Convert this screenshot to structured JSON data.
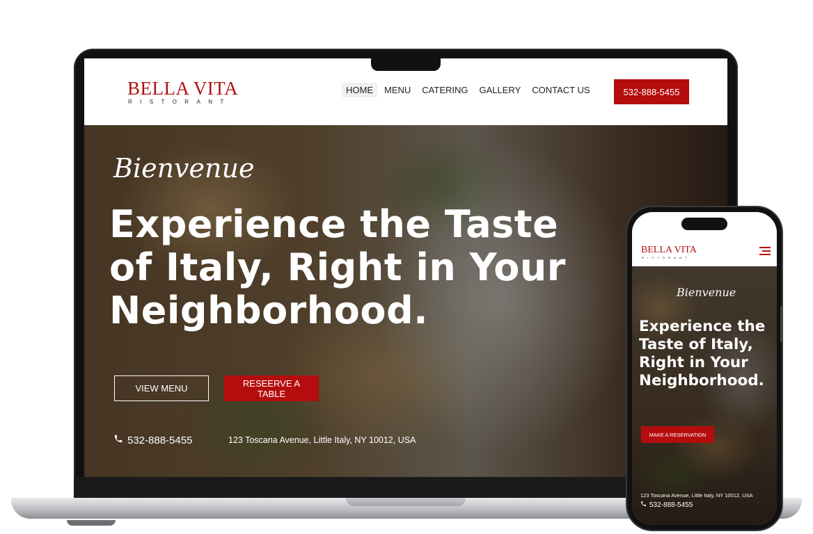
{
  "desktop": {
    "logo": {
      "name": "BELLA VITA",
      "tagline": "RISTORANT"
    },
    "nav": [
      "HOME",
      "MENU",
      "CATERING",
      "GALLERY",
      "CONTACT US"
    ],
    "header_phone": "532-888-5455",
    "hero": {
      "script_title": "Bienvenue",
      "heading": "Experience the Taste of Italy, Right in Your Neighborhood.",
      "view_menu": "VIEW MENU",
      "reserve": "RESEERVE A TABLE",
      "phone": "532-888-5455",
      "address": "123 Toscana Avenue, Little Italy, NY 10012, USA"
    }
  },
  "mobile": {
    "logo": {
      "name": "BELLA VITA",
      "tagline": "RISTORANT"
    },
    "hero": {
      "script_title": "Bienvenue",
      "heading": "Experience the Taste of Italy, Right in Your Neighborhood.",
      "reserve": "MAKE A RESERVATION",
      "address": "123 Toscana Avenue, Little Italy, NY 10012, USA",
      "phone": "532-888-5455"
    }
  },
  "colors": {
    "brand_red": "#b50d0d",
    "text_dark": "#222222",
    "white": "#ffffff"
  },
  "icons": [
    "phone-icon",
    "hamburger-menu-icon"
  ]
}
